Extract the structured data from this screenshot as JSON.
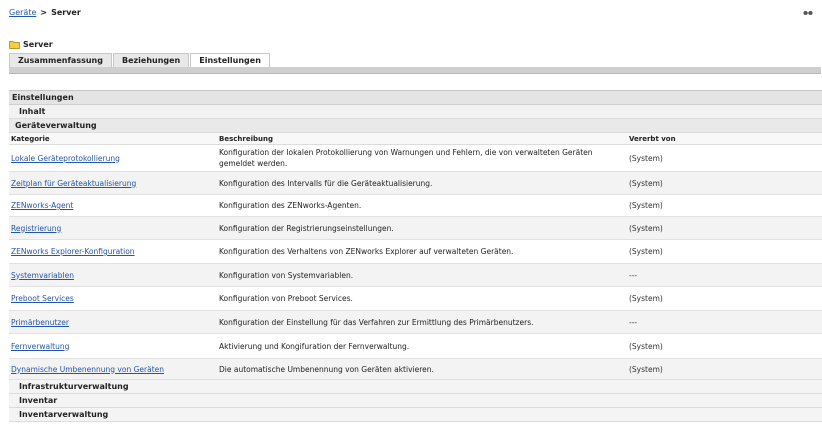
{
  "breadcrumb": {
    "link": "Geräte",
    "separator": ">",
    "current": "Server"
  },
  "page": {
    "title": "Server"
  },
  "tabs": [
    {
      "label": "Zusammenfassung",
      "active": false
    },
    {
      "label": "Beziehungen",
      "active": false
    },
    {
      "label": "Einstellungen",
      "active": true
    }
  ],
  "settings": {
    "header": "Einstellungen",
    "sections_top": [
      "Inhalt"
    ],
    "open_section": "Geräteverwaltung",
    "columns": {
      "category": "Kategorie",
      "description": "Beschreibung",
      "inherited": "Vererbt von"
    },
    "rows": [
      {
        "category": "Lokale Geräteprotokollierung",
        "description": "Konfiguration der lokalen Protokollierung von Warnungen und Fehlern, die von verwalteten Geräten gemeldet werden.",
        "inherited": "(System)"
      },
      {
        "category": "Zeitplan für Geräteaktualisierung",
        "description": "Konfiguration des Intervalls für die Geräteaktualisierung.",
        "inherited": "(System)"
      },
      {
        "category": "ZENworks-Agent",
        "description": "Konfiguration des ZENworks-Agenten.",
        "inherited": "(System)"
      },
      {
        "category": "Registrierung",
        "description": "Konfiguration der Registrierungseinstellungen.",
        "inherited": "(System)"
      },
      {
        "category": "ZENworks Explorer-Konfiguration",
        "description": "Konfiguration des Verhaltens von ZENworks Explorer auf verwalteten Geräten.",
        "inherited": "(System)"
      },
      {
        "category": "Systemvariablen",
        "description": "Konfiguration von Systemvariablen.",
        "inherited": "---"
      },
      {
        "category": "Preboot Services",
        "description": "Konfiguration von Preboot Services.",
        "inherited": "(System)"
      },
      {
        "category": "Primärbenutzer",
        "description": "Konfiguration der Einstellung für das Verfahren zur Ermittlung des Primärbenutzers.",
        "inherited": "---"
      },
      {
        "category": "Fernverwaltung",
        "description": "Aktivierung und Kongifuration der Fernverwaltung.",
        "inherited": "(System)"
      },
      {
        "category": "Dynamische Umbenennung von Geräten",
        "description": "Die automatische Umbenennung von Geräten aktivieren.",
        "inherited": "(System)"
      }
    ],
    "sections_bottom": [
      "Infrastrukturverwaltung",
      "Inventar",
      "Inventarverwaltung"
    ]
  }
}
